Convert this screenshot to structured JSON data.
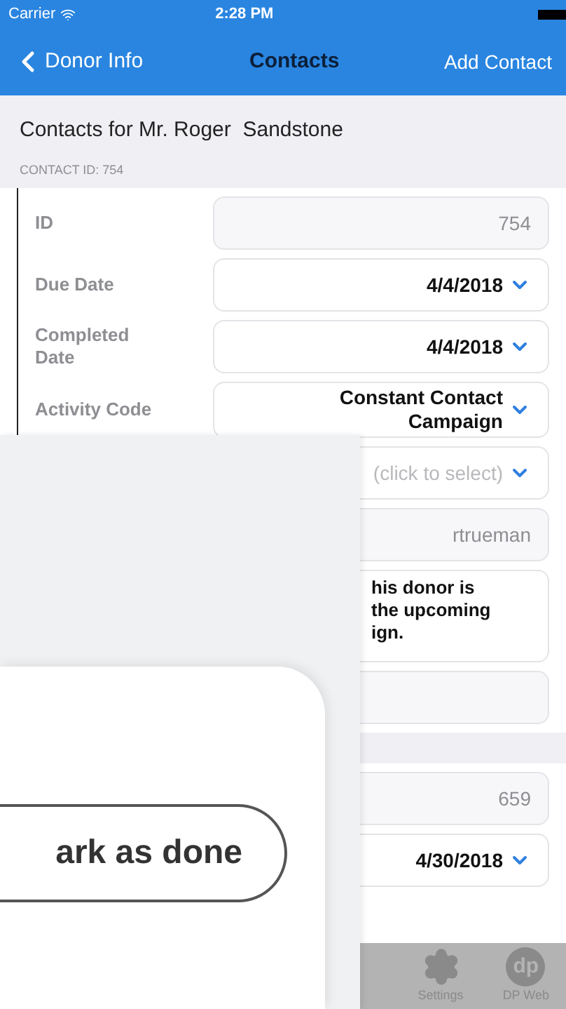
{
  "status_bar": {
    "carrier": "Carrier",
    "time": "2:28 PM"
  },
  "nav": {
    "back": "Donor Info",
    "title": "Contacts",
    "action": "Add Contact"
  },
  "header": {
    "title": "Contacts for Mr. Roger  Sandstone",
    "subtitle": "CONTACT ID: 754"
  },
  "fields": [
    {
      "kind": "readonly",
      "label": "ID",
      "value": "754"
    },
    {
      "kind": "picker",
      "label": "Due Date",
      "value": "4/4/2018"
    },
    {
      "kind": "picker",
      "label": "Completed Date",
      "value": "4/4/2018"
    },
    {
      "kind": "picker",
      "label": "Activity Code",
      "value": "Constant Contact Campaign"
    },
    {
      "kind": "picker",
      "placeholder": "(click to select)"
    },
    {
      "kind": "readonly",
      "value": "rtrueman"
    },
    {
      "kind": "notes",
      "lines": [
        "his donor is",
        "the upcoming",
        "ign."
      ]
    },
    {
      "kind": "readonly"
    },
    {
      "kind": "section"
    },
    {
      "kind": "readonly",
      "value": "659"
    },
    {
      "kind": "picker",
      "value": "4/30/2018"
    }
  ],
  "tab_bar": [
    {
      "kind": "gear",
      "label": "Settings"
    },
    {
      "kind": "logo",
      "logo": "dp",
      "label": "DP Web"
    }
  ],
  "overlay": {
    "button": "ark as done"
  }
}
